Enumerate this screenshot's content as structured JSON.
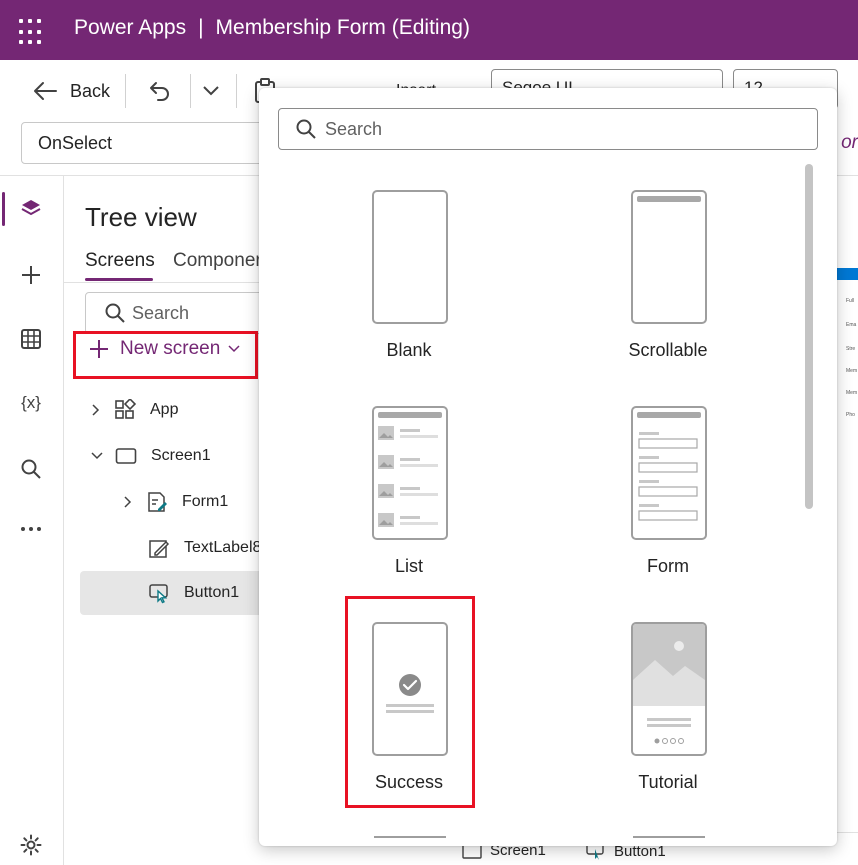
{
  "header": {
    "app_name": "Power Apps",
    "separator": "|",
    "doc_title": "Membership Form (Editing)"
  },
  "toolbar": {
    "back_label": "Back",
    "insert_label": "Insert",
    "font_value": "Segoe UI",
    "font_size_value": "12"
  },
  "formula": {
    "property": "OnSelect",
    "hint": "or"
  },
  "rail": {
    "icons": [
      "layers-icon",
      "plus-icon",
      "data-table-icon",
      "variables-icon",
      "search-icon",
      "more-icon",
      "settings-icon"
    ],
    "variables_glyph": "{x}"
  },
  "tree": {
    "title": "Tree view",
    "tab_screens": "Screens",
    "tab_components": "Componer",
    "search_placeholder": "Search",
    "new_screen_label": "New screen",
    "nodes": {
      "app": "App",
      "screen1": "Screen1",
      "form1": "Form1",
      "textlabel8": "TextLabel8",
      "button1": "Button1"
    }
  },
  "bottom": {
    "screen": "Screen1",
    "button": "Button1"
  },
  "flyout": {
    "search_placeholder": "Search",
    "templates": {
      "blank": "Blank",
      "scrollable": "Scrollable",
      "list": "List",
      "form": "Form",
      "success": "Success",
      "tutorial": "Tutorial"
    }
  },
  "colors": {
    "brand": "#742774",
    "highlight": "#e81123"
  }
}
